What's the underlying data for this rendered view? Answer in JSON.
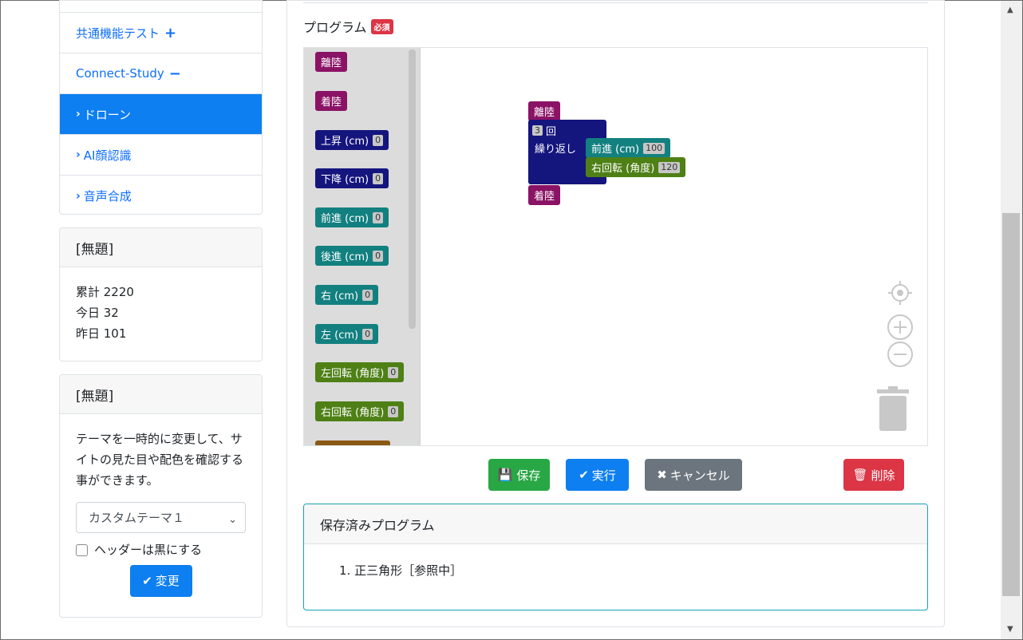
{
  "sidebar": {
    "menu": [
      {
        "label": "共通機能テスト",
        "suffix": "+",
        "active": false
      },
      {
        "label": "Connect-Study",
        "suffix": "−",
        "active": false
      },
      {
        "label": "ドローン",
        "prefix": "›",
        "active": true
      },
      {
        "label": "AI顔認識",
        "prefix": "›",
        "active": false
      },
      {
        "label": "音声合成",
        "prefix": "›",
        "active": false
      }
    ],
    "counter_card": {
      "title": "[無題]",
      "lines": [
        "累計 2220",
        "今日 32",
        "昨日 101"
      ]
    },
    "theme_card": {
      "title": "[無題]",
      "description": "テーマを一時的に変更して、サイトの見た目や配色を確認する事ができます。",
      "select_value": "カスタムテーマ１",
      "checkbox_label": "ヘッダーは黒にする",
      "change_button": "変更"
    }
  },
  "program": {
    "label": "プログラム",
    "required_badge": "必須",
    "toolbox": [
      {
        "label": "離陸",
        "color": "#8b1366"
      },
      {
        "label": "着陸",
        "color": "#8b1366"
      },
      {
        "label": "上昇 (cm)",
        "value": "0",
        "color": "#15157e"
      },
      {
        "label": "下降 (cm)",
        "value": "0",
        "color": "#15157e"
      },
      {
        "label": "前進 (cm)",
        "value": "0",
        "color": "#138080"
      },
      {
        "label": "後進 (cm)",
        "value": "0",
        "color": "#138080"
      },
      {
        "label": "右 (cm)",
        "value": "0",
        "color": "#138080"
      },
      {
        "label": "左 (cm)",
        "value": "0",
        "color": "#138080"
      },
      {
        "label": "左回転 (角度)",
        "value": "0",
        "color": "#4e8016"
      },
      {
        "label": "右回転 (角度)",
        "value": "0",
        "color": "#4e8016"
      }
    ],
    "canvas": {
      "takeoff": "離陸",
      "repeat_count": "3",
      "repeat_unit": "回",
      "repeat_label": "繰り返し",
      "forward": {
        "label": "前進 (cm)",
        "value": "100"
      },
      "turn_right": {
        "label": "右回転 (角度)",
        "value": "120"
      },
      "land": "着陸"
    },
    "controls": {
      "recenter_icon": "crosshair-icon",
      "zoom_in_icon": "zoom-in-icon",
      "zoom_out_icon": "zoom-out-icon",
      "trash_icon": "trash-icon"
    }
  },
  "actions": {
    "save": "保存",
    "run": "実行",
    "cancel": "キャンセル",
    "delete": "削除"
  },
  "saved": {
    "title": "保存済みプログラム",
    "items": [
      "1. 正三角形［参照中］"
    ]
  },
  "colors": {
    "primary": "#0d7ff0",
    "success": "#28a745",
    "secondary": "#6c757d",
    "danger": "#dc3545",
    "info": "#17a2b8"
  }
}
